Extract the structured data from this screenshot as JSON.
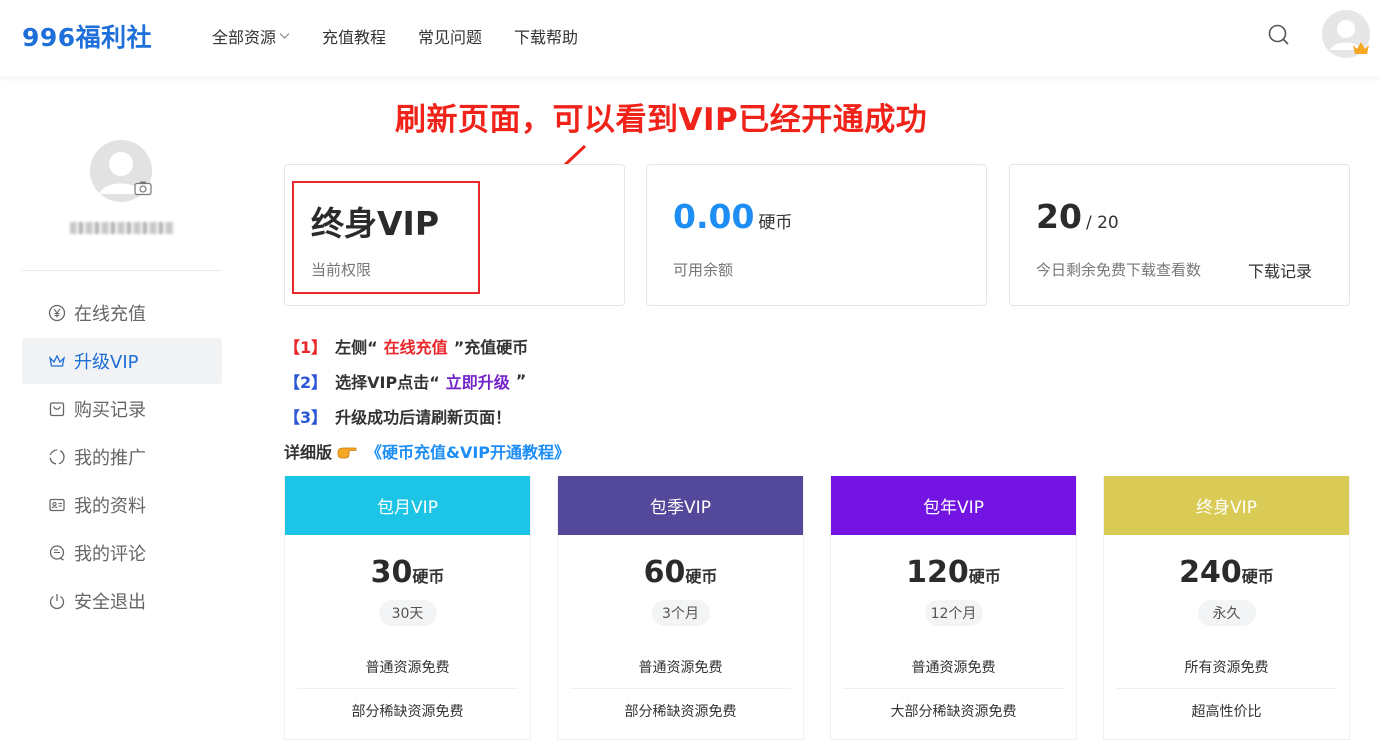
{
  "header": {
    "logo": "996福利社",
    "nav": [
      {
        "label": "全部资源",
        "has_caret": true
      },
      {
        "label": "充值教程"
      },
      {
        "label": "常见问题"
      },
      {
        "label": "下载帮助"
      }
    ],
    "search_icon": "search-icon",
    "user_icon": "user-avatar-icon"
  },
  "sidebar": {
    "menu": [
      {
        "label": "在线充值",
        "icon": "yen-circle-icon",
        "active": false
      },
      {
        "label": "升级VIP",
        "icon": "crown-icon",
        "active": true
      },
      {
        "label": "购买记录",
        "icon": "bag-icon",
        "active": false
      },
      {
        "label": "我的推广",
        "icon": "loading-circle-icon",
        "active": false
      },
      {
        "label": "我的资料",
        "icon": "id-card-icon",
        "active": false
      },
      {
        "label": "我的评论",
        "icon": "comment-icon",
        "active": false
      },
      {
        "label": "安全退出",
        "icon": "power-icon",
        "active": false
      }
    ]
  },
  "annotation": "刷新页面，可以看到VIP已经开通成功",
  "stats": {
    "vip": {
      "value": "终身VIP",
      "label": "当前权限"
    },
    "balance": {
      "value": "0.00",
      "unit": "硬币",
      "label": "可用余额"
    },
    "downloads": {
      "value": "20",
      "total": "/ 20",
      "label": "今日剩余免费下载查看数",
      "link": "下载记录"
    }
  },
  "steps": [
    {
      "num": "【1】",
      "pre": "左侧“",
      "highlight": "在线充值",
      "post": "”充值硬币"
    },
    {
      "num": "【2】",
      "pre": "选择VIP点击“",
      "highlight": "立即升级",
      "post": "”"
    },
    {
      "num": "【3】",
      "pre": "升级成功后请刷新页面！",
      "highlight": "",
      "post": ""
    }
  ],
  "detail": {
    "prefix": "详细版",
    "icon": "pointing-hand-icon",
    "link": "《硬币充值&VIP开通教程》"
  },
  "plans": [
    {
      "name": "包月VIP",
      "price": "30",
      "unit": "硬币",
      "period": "30天",
      "features": [
        "普通资源免费",
        "部分稀缺资源免费"
      ],
      "color": "#1cc4e6"
    },
    {
      "name": "包季VIP",
      "price": "60",
      "unit": "硬币",
      "period": "3个月",
      "features": [
        "普通资源免费",
        "部分稀缺资源免费"
      ],
      "color": "#53489a"
    },
    {
      "name": "包年VIP",
      "price": "120",
      "unit": "硬币",
      "period": "12个月",
      "features": [
        "普通资源免费",
        "大部分稀缺资源免费"
      ],
      "color": "#7314e3"
    },
    {
      "name": "终身VIP",
      "price": "240",
      "unit": "硬币",
      "period": "永久",
      "features": [
        "所有资源免费",
        "超高性价比"
      ],
      "color": "#d9cb55"
    }
  ]
}
